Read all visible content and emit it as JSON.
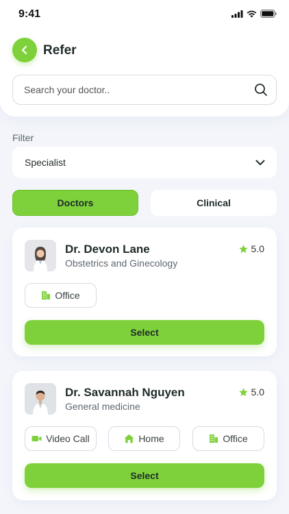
{
  "status_bar": {
    "time": "9:41"
  },
  "header": {
    "title": "Refer"
  },
  "search": {
    "placeholder": "Search your doctor.."
  },
  "filter": {
    "label": "Filter",
    "selected": "Specialist"
  },
  "tabs": [
    {
      "label": "Doctors",
      "active": true
    },
    {
      "label": "Clinical",
      "active": false
    }
  ],
  "doctors": [
    {
      "name": "Dr. Devon Lane",
      "specialty": "Obstetrics and Ginecology",
      "rating": "5.0",
      "options": [
        {
          "label": "Office",
          "icon": "building-icon"
        }
      ],
      "select_label": "Select"
    },
    {
      "name": "Dr. Savannah Nguyen",
      "specialty": "General medicine",
      "rating": "5.0",
      "options": [
        {
          "label": "Video Call",
          "icon": "video-icon"
        },
        {
          "label": "Home",
          "icon": "home-icon"
        },
        {
          "label": "Office",
          "icon": "building-icon"
        }
      ],
      "select_label": "Select"
    }
  ],
  "colors": {
    "accent": "#7ed13a",
    "background": "#f3f5fb",
    "text": "#1f2a2a"
  }
}
